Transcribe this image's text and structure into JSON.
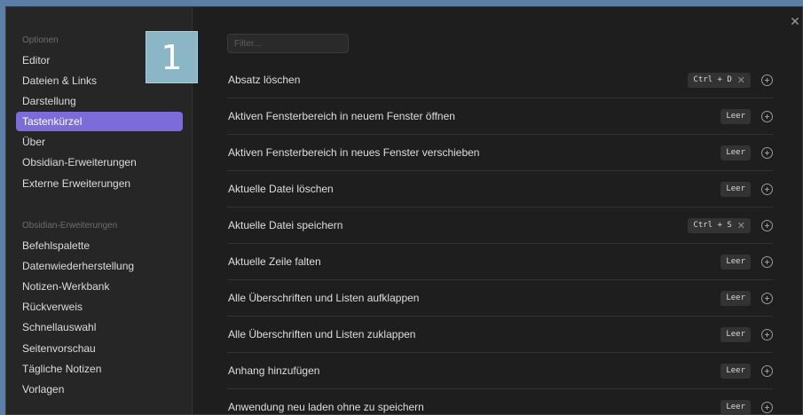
{
  "sidebar": {
    "section_options": "Optionen",
    "options": [
      "Editor",
      "Dateien & Links",
      "Darstellung",
      "Tastenkürzel",
      "Über",
      "Obsidian-Erweiterungen",
      "Externe Erweiterungen"
    ],
    "section_plugins": "Obsidian-Erweiterungen",
    "plugins": [
      "Befehlspalette",
      "Datenwiederherstellung",
      "Notizen-Werkbank",
      "Rückverweis",
      "Schnellauswahl",
      "Seitenvorschau",
      "Tägliche Notizen",
      "Vorlagen"
    ],
    "active_item": "Tastenkürzel",
    "accent_color": "#7b6cd9"
  },
  "badge": {
    "label": "1"
  },
  "close_icon": "close-icon",
  "filter": {
    "placeholder": "Filter...",
    "value": ""
  },
  "hotkeys": [
    {
      "label": "Absatz löschen",
      "key": "Ctrl + D",
      "removable": true
    },
    {
      "label": "Aktiven Fensterbereich in neuem Fenster öffnen",
      "key": "Leer",
      "removable": false
    },
    {
      "label": "Aktiven Fensterbereich in neues Fenster verschieben",
      "key": "Leer",
      "removable": false
    },
    {
      "label": "Aktuelle Datei löschen",
      "key": "Leer",
      "removable": false
    },
    {
      "label": "Aktuelle Datei speichern",
      "key": "Ctrl + S",
      "removable": true
    },
    {
      "label": "Aktuelle Zeile falten",
      "key": "Leer",
      "removable": false
    },
    {
      "label": "Alle Überschriften und Listen aufklappen",
      "key": "Leer",
      "removable": false
    },
    {
      "label": "Alle Überschriften und Listen zuklappen",
      "key": "Leer",
      "removable": false
    },
    {
      "label": "Anhang hinzufügen",
      "key": "Leer",
      "removable": false
    },
    {
      "label": "Anwendung neu laden ohne zu speichern",
      "key": "Leer",
      "removable": false
    }
  ]
}
